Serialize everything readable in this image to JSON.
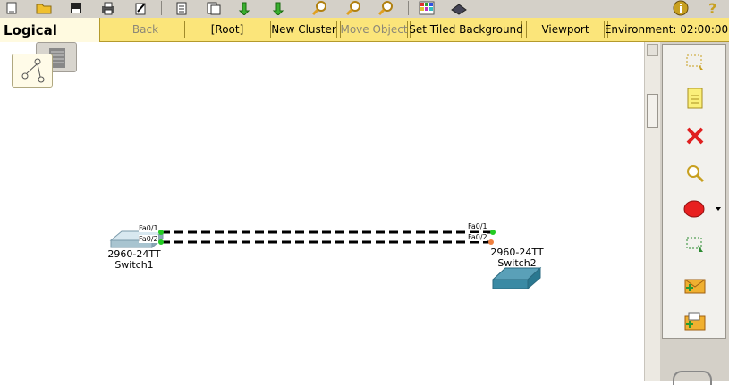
{
  "toolbar": {
    "icons": [
      "new-file-icon",
      "open-folder-icon",
      "save-icon",
      "print-icon",
      "edit-icon",
      "clipboard-icon",
      "document-list-icon",
      "copy-arrows-icon",
      "paste-arrows-icon",
      "zoom-in-icon",
      "zoom-reset-icon",
      "zoom-out-icon",
      "palette-icon",
      "device-book-icon",
      "info-icon",
      "help-icon"
    ]
  },
  "navbar": {
    "mode_label": "Logical",
    "back_label": "Back",
    "root_label": "[Root]",
    "new_cluster_label": "New Cluster",
    "move_object_label": "Move Object",
    "set_tiled_background_label": "Set Tiled Background",
    "viewport_label": "Viewport",
    "environment_label": "Environment: 02:00:00"
  },
  "right_panel": {
    "tools": [
      "select-icon",
      "note-icon",
      "delete-icon",
      "inspect-icon",
      "draw-ellipse-icon",
      "resize-icon",
      "add-simple-pdu-icon",
      "add-complex-pdu-icon"
    ]
  },
  "topology": {
    "devices": [
      {
        "model": "2960-24TT",
        "name": "Switch1"
      },
      {
        "model": "2960-24TT",
        "name": "Switch2"
      }
    ],
    "links": [
      {
        "from_port": "Fa0/1",
        "to_port": "Fa0/1",
        "from_status": "up",
        "to_status": "up"
      },
      {
        "from_port": "Fa0/2",
        "to_port": "Fa0/2",
        "from_status": "up",
        "to_status": "blocking"
      }
    ],
    "status_colors": {
      "up": "#22cc22",
      "blocking": "#f08040"
    }
  }
}
